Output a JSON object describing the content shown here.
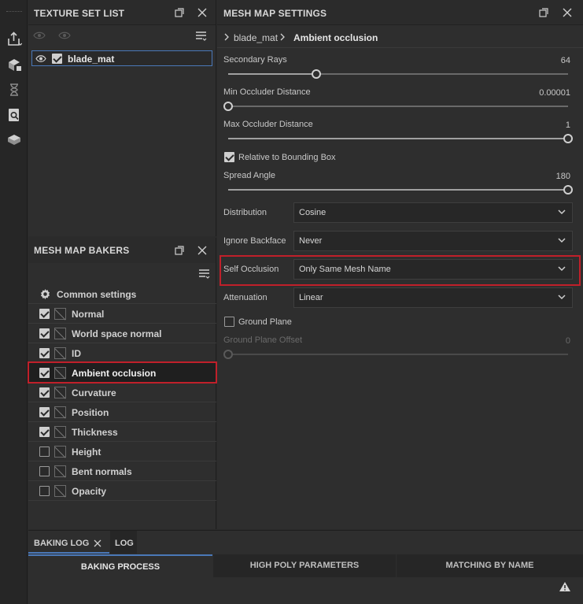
{
  "texture_set_list": {
    "title": "TEXTURE SET LIST",
    "items": [
      {
        "label": "blade_mat"
      }
    ]
  },
  "mesh_map_bakers": {
    "title": "MESH MAP BAKERS",
    "common_settings": "Common settings",
    "items": [
      {
        "label": "Normal",
        "checked": true
      },
      {
        "label": "World space normal",
        "checked": true
      },
      {
        "label": "ID",
        "checked": true
      },
      {
        "label": "Ambient occlusion",
        "checked": true,
        "selected": true
      },
      {
        "label": "Curvature",
        "checked": true
      },
      {
        "label": "Position",
        "checked": true
      },
      {
        "label": "Thickness",
        "checked": true
      },
      {
        "label": "Height",
        "checked": false
      },
      {
        "label": "Bent normals",
        "checked": false
      },
      {
        "label": "Opacity",
        "checked": false
      }
    ]
  },
  "mesh_map_settings": {
    "title": "MESH MAP SETTINGS",
    "breadcrumb": {
      "parent": "blade_mat",
      "current": "Ambient occlusion"
    },
    "secondary_rays": {
      "label": "Secondary Rays",
      "value": "64",
      "fraction": 0.26
    },
    "min_occluder_distance": {
      "label": "Min Occluder Distance",
      "value": "0.00001",
      "fraction": 0.0
    },
    "max_occluder_distance": {
      "label": "Max Occluder Distance",
      "value": "1",
      "fraction": 1.0
    },
    "relative_to_bounding_box": {
      "label": "Relative to Bounding Box",
      "checked": true
    },
    "spread_angle": {
      "label": "Spread Angle",
      "value": "180",
      "fraction": 1.0
    },
    "distribution": {
      "label": "Distribution",
      "value": "Cosine"
    },
    "ignore_backface": {
      "label": "Ignore Backface",
      "value": "Never"
    },
    "self_occlusion": {
      "label": "Self Occlusion",
      "value": "Only Same Mesh Name"
    },
    "attenuation": {
      "label": "Attenuation",
      "value": "Linear"
    },
    "ground_plane": {
      "label": "Ground Plane",
      "checked": false
    },
    "ground_plane_offset": {
      "label": "Ground Plane Offset",
      "value": "0",
      "fraction": 0.0
    }
  },
  "bottom": {
    "tabs": [
      {
        "label": "BAKING LOG"
      },
      {
        "label": "LOG"
      }
    ],
    "subtabs": [
      {
        "label": "BAKING PROCESS"
      },
      {
        "label": "HIGH POLY PARAMETERS"
      },
      {
        "label": "MATCHING BY NAME"
      }
    ]
  },
  "colors": {
    "accent": "#4a78b8",
    "highlight": "#c0202a"
  }
}
